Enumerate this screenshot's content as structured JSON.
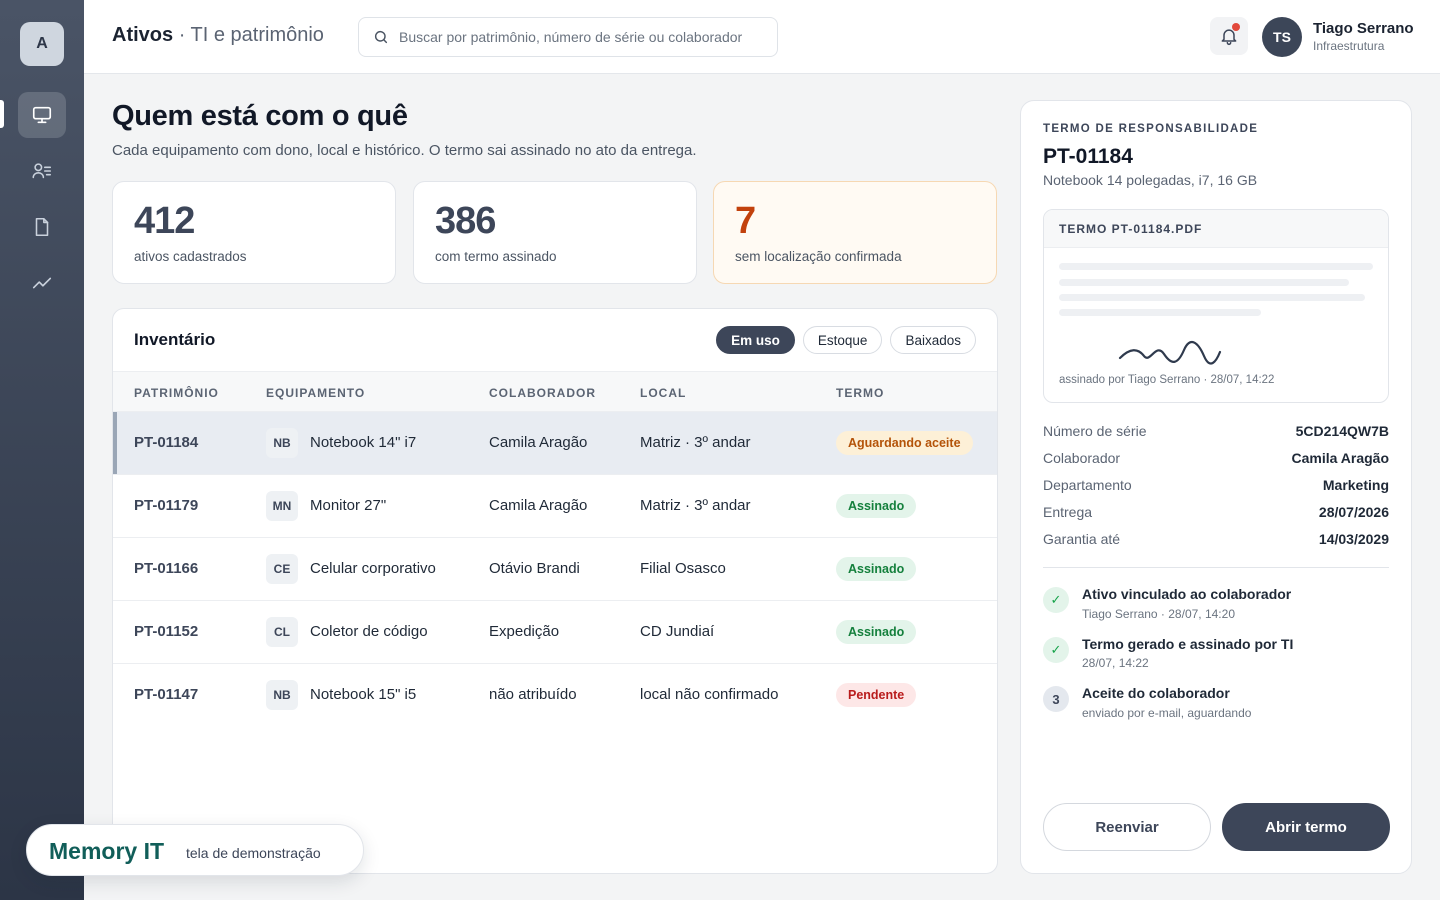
{
  "sidebar": {
    "logo_letter": "A",
    "items": [
      {
        "name": "Ativos",
        "icon": "monitor-icon",
        "active": true
      },
      {
        "name": "Colaboradores",
        "icon": "users-list-icon",
        "active": false
      },
      {
        "name": "Termos",
        "icon": "document-icon",
        "active": false
      },
      {
        "name": "Relatórios",
        "icon": "trend-chart-icon",
        "active": false
      }
    ]
  },
  "header": {
    "title": "Ativos",
    "subtitle": "· TI e patrimônio",
    "search_placeholder": "Buscar por patrimônio, número de série ou colaborador",
    "user": {
      "initials": "TS",
      "name": "Tiago Serrano",
      "role": "Infraestrutura"
    }
  },
  "main": {
    "title": "Quem está com o quê",
    "subtitle": "Cada equipamento com dono, local e histórico. O termo sai assinado no ato da entrega.",
    "stats": [
      {
        "value": "412",
        "label": "ativos cadastrados"
      },
      {
        "value": "386",
        "label": "com termo assinado"
      },
      {
        "value": "7",
        "label": "sem localização confirmada"
      }
    ]
  },
  "inventory": {
    "title": "Inventário",
    "filters": [
      "Em uso",
      "Estoque",
      "Baixados"
    ],
    "active_filter": "Em uso",
    "columns": [
      "PATRIMÔNIO",
      "EQUIPAMENTO",
      "COLABORADOR",
      "LOCAL",
      "TERMO"
    ],
    "rows": [
      {
        "code": "PT-01184",
        "tag": "NB",
        "equipment": "Notebook 14\" i7",
        "collaborator": "Camila Aragão",
        "location": "Matriz · 3º andar",
        "status": "Aguardando aceite",
        "status_kind": "wait"
      },
      {
        "code": "PT-01179",
        "tag": "MN",
        "equipment": "Monitor 27\"",
        "collaborator": "Camila Aragão",
        "location": "Matriz · 3º andar",
        "status": "Assinado",
        "status_kind": "ok"
      },
      {
        "code": "PT-01166",
        "tag": "CE",
        "equipment": "Celular corporativo",
        "collaborator": "Otávio Brandi",
        "location": "Filial Osasco",
        "status": "Assinado",
        "status_kind": "ok"
      },
      {
        "code": "PT-01152",
        "tag": "CL",
        "equipment": "Coletor de código",
        "collaborator": "Expedição",
        "location": "CD Jundiaí",
        "status": "Assinado",
        "status_kind": "ok"
      },
      {
        "code": "PT-01147",
        "tag": "NB",
        "equipment": "Notebook 15\" i5",
        "collaborator": "não atribuído",
        "location": "local não confirmado",
        "status": "Pendente",
        "status_kind": "pend"
      }
    ]
  },
  "panel": {
    "eyebrow": "TERMO DE RESPONSABILIDADE",
    "code": "PT-01184",
    "description": "Notebook 14 polegadas, i7, 16 GB",
    "document": {
      "title": "TERMO PT-01184.PDF",
      "signed_by": "assinado por Tiago Serrano · 28/07, 14:22"
    },
    "details": [
      {
        "key": "Número de série",
        "value": "5CD214QW7B"
      },
      {
        "key": "Colaborador",
        "value": "Camila Aragão"
      },
      {
        "key": "Departamento",
        "value": "Marketing"
      },
      {
        "key": "Entrega",
        "value": "28/07/2026"
      },
      {
        "key": "Garantia até",
        "value": "14/03/2029"
      }
    ],
    "timeline": [
      {
        "marker": "✓",
        "title": "Ativo vinculado ao colaborador",
        "meta": "Tiago Serrano · 28/07, 14:20",
        "done": true
      },
      {
        "marker": "✓",
        "title": "Termo gerado e assinado por TI",
        "meta": "28/07, 14:22",
        "done": true
      },
      {
        "marker": "3",
        "title": "Aceite do colaborador",
        "meta": "enviado por e-mail, aguardando",
        "done": false
      }
    ],
    "buttons": {
      "secondary": "Reenviar",
      "primary": "Abrir termo"
    }
  },
  "brand": {
    "name": "Memory IT",
    "tagline": "tela de demonstração"
  },
  "colors": {
    "accent": "#3d4659",
    "warning": "#c2410c",
    "success": "#15803d",
    "danger": "#b91c1c",
    "brand": "#115e59"
  }
}
